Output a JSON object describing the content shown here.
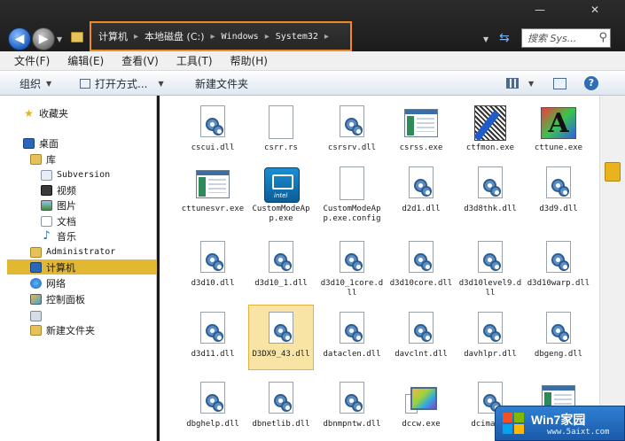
{
  "titlebar": {
    "minimize_glyph": "—",
    "close_glyph": "✕"
  },
  "address": {
    "crumbs": [
      "计算机",
      "本地磁盘 (C:)",
      "Windows",
      "System32"
    ],
    "separator": "▸"
  },
  "search": {
    "placeholder": "搜索 Sys..."
  },
  "menu": {
    "items": [
      "文件(F)",
      "编辑(E)",
      "查看(V)",
      "工具(T)",
      "帮助(H)"
    ]
  },
  "toolbar": {
    "organize": "组织",
    "open_with": "打开方式...",
    "new_folder": "新建文件夹"
  },
  "nav": {
    "favorites": "收藏夹",
    "desktop": "桌面",
    "libraries": "库",
    "subversion": "Subversion",
    "videos": "视频",
    "pictures": "图片",
    "documents": "文档",
    "music": "音乐",
    "administrator": "Administrator",
    "computer": "计算机",
    "network": "网络",
    "control_panel": "控制面板",
    "new_folder": "新建文件夹"
  },
  "files": [
    {
      "name": "cscui.dll",
      "icon": "dll"
    },
    {
      "name": "csrr.rs",
      "icon": "blank"
    },
    {
      "name": "csrsrv.dll",
      "icon": "dll"
    },
    {
      "name": "csrss.exe",
      "icon": "window-app"
    },
    {
      "name": "ctfmon.exe",
      "icon": "pen-app"
    },
    {
      "name": "cttune.exe",
      "icon": "cleartype-app"
    },
    {
      "name": "cttunesvr.exe",
      "icon": "window-app"
    },
    {
      "name": "CustomModeApp.exe",
      "icon": "intel-app"
    },
    {
      "name": "CustomModeApp.exe.config",
      "icon": "blank"
    },
    {
      "name": "d2d1.dll",
      "icon": "dll"
    },
    {
      "name": "d3d8thk.dll",
      "icon": "dll"
    },
    {
      "name": "d3d9.dll",
      "icon": "dll"
    },
    {
      "name": "d3d10.dll",
      "icon": "dll"
    },
    {
      "name": "d3d10_1.dll",
      "icon": "dll"
    },
    {
      "name": "d3d10_1core.dll",
      "icon": "dll"
    },
    {
      "name": "d3d10core.dll",
      "icon": "dll"
    },
    {
      "name": "d3d10level9.dll",
      "icon": "dll"
    },
    {
      "name": "d3d10warp.dll",
      "icon": "dll"
    },
    {
      "name": "d3d11.dll",
      "icon": "dll"
    },
    {
      "name": "D3DX9_43.dll",
      "icon": "dll",
      "selected": true
    },
    {
      "name": "dataclen.dll",
      "icon": "dll"
    },
    {
      "name": "davclnt.dll",
      "icon": "dll"
    },
    {
      "name": "davhlpr.dll",
      "icon": "dll"
    },
    {
      "name": "dbgeng.dll",
      "icon": "dll"
    },
    {
      "name": "dbghelp.dll",
      "icon": "dll"
    },
    {
      "name": "dbnetlib.dll",
      "icon": "dll"
    },
    {
      "name": "dbnmpntw.dll",
      "icon": "dll"
    },
    {
      "name": "dccw.exe",
      "icon": "color-calibration-app"
    },
    {
      "name": "dcima...",
      "icon": "dll"
    },
    {
      "name": "",
      "icon": "window-app"
    }
  ],
  "watermark": {
    "title": "Win7家园",
    "url": "www.5aixt.com"
  },
  "colors": {
    "address_highlight": "#f08a24",
    "selection": "#e2b731",
    "scroll_thumb": "#e9b320"
  }
}
